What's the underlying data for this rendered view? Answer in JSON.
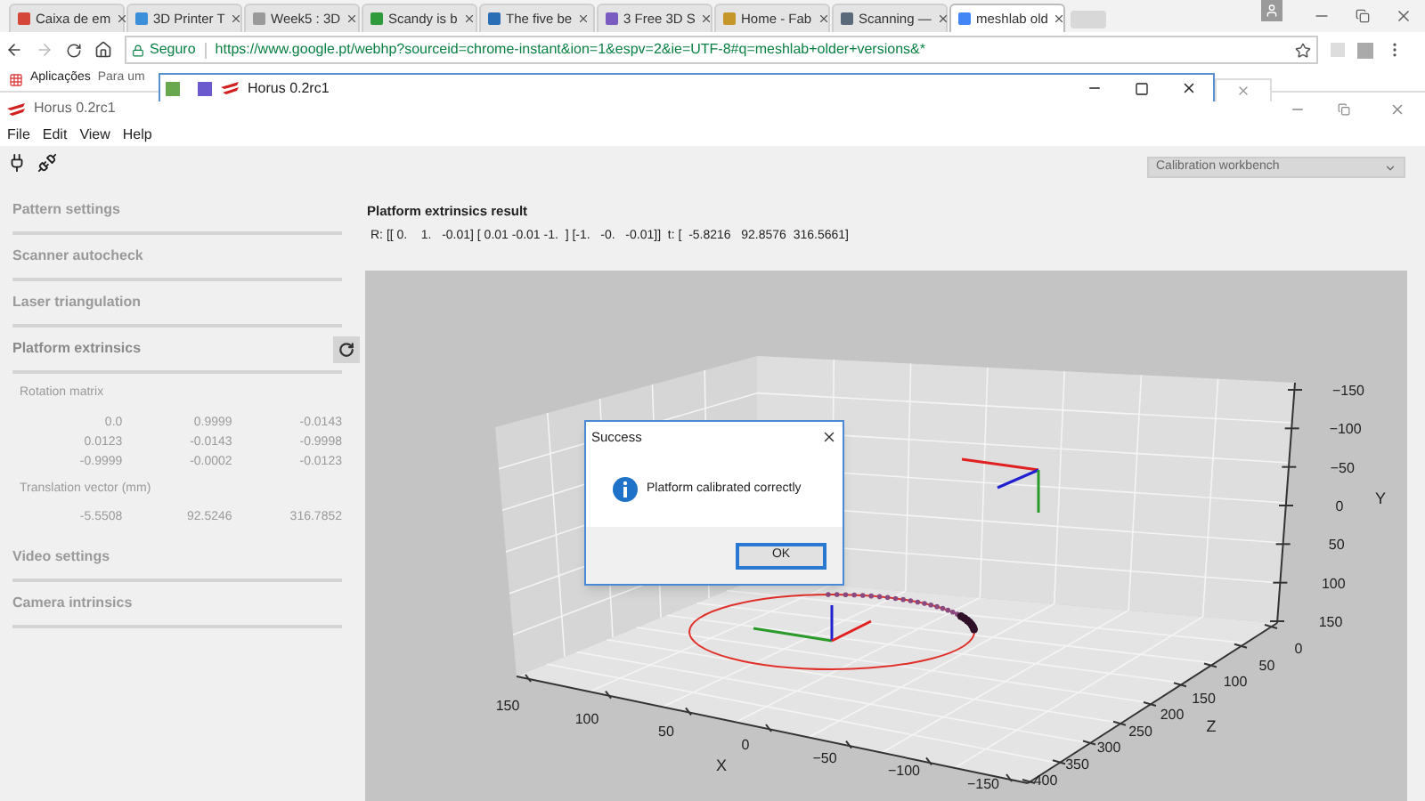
{
  "browser": {
    "tabs": [
      {
        "title": "Caixa de em",
        "selected": false,
        "color": "#d44638"
      },
      {
        "title": "3D Printer T",
        "selected": false,
        "color": "#3b8fd9"
      },
      {
        "title": "Week5 : 3D",
        "selected": false,
        "color": "#9a9a9a"
      },
      {
        "title": "Scandy is b",
        "selected": false,
        "color": "#2f9a3c"
      },
      {
        "title": "The five be",
        "selected": false,
        "color": "#2a6fb5"
      },
      {
        "title": "3 Free 3D S",
        "selected": false,
        "color": "#7a5cc0"
      },
      {
        "title": "Home - Fab",
        "selected": false,
        "color": "#c7962a"
      },
      {
        "title": "Scanning —",
        "selected": false,
        "color": "#5a6a7a"
      },
      {
        "title": "meshlab old",
        "selected": true,
        "color": "#4285f4"
      }
    ],
    "address": {
      "security": "Seguro",
      "url": "https://www.google.pt/webhp?sourceid=chrome-instant&ion=1&espv=2&ie=UTF-8#q=meshlab+older+versions&*"
    },
    "bookmarks": [
      "Aplicações",
      "Para um"
    ]
  },
  "background_window": {
    "title": "Horus 0.2rc1"
  },
  "window": {
    "title": "Horus 0.2rc1",
    "menu": [
      "File",
      "Edit",
      "View",
      "Help"
    ],
    "workbench": "Calibration workbench"
  },
  "sidebar": {
    "sections": [
      {
        "title": "Pattern settings",
        "expanded": false
      },
      {
        "title": "Scanner autocheck",
        "expanded": false
      },
      {
        "title": "Laser triangulation",
        "expanded": false
      },
      {
        "title": "Platform extrinsics",
        "expanded": true,
        "rotation_label": "Rotation matrix",
        "rotation": [
          [
            "0.0",
            "0.9999",
            "-0.0143"
          ],
          [
            "0.0123",
            "-0.0143",
            "-0.9998"
          ],
          [
            "-0.9999",
            "-0.0002",
            "-0.0123"
          ]
        ],
        "translation_label": "Translation vector (mm)",
        "translation": [
          "-5.5508",
          "92.5246",
          "316.7852"
        ]
      },
      {
        "title": "Video settings",
        "expanded": false
      },
      {
        "title": "Camera intrinsics",
        "expanded": false
      }
    ]
  },
  "result": {
    "title": "Platform extrinsics result",
    "text": "R: [[ 0.    1.   -0.01] [ 0.01 -0.01 -1.  ] [-1.   -0.   -0.01]]  t: [  -5.8216   92.8576  316.5661]"
  },
  "plot": {
    "x_label": "X",
    "y_label": "Y",
    "z_label": "Z",
    "x_ticks": [
      "150",
      "100",
      "50",
      "0",
      "−50",
      "−100",
      "−150"
    ],
    "y_ticks": [
      "−150",
      "−100",
      "−50",
      "0",
      "50",
      "100",
      "150"
    ],
    "z_ticks": [
      "0",
      "50",
      "100",
      "150",
      "200",
      "250",
      "300",
      "350",
      "400"
    ]
  },
  "dialog": {
    "title": "Success",
    "message": "Platform calibrated correctly",
    "button": "OK"
  }
}
